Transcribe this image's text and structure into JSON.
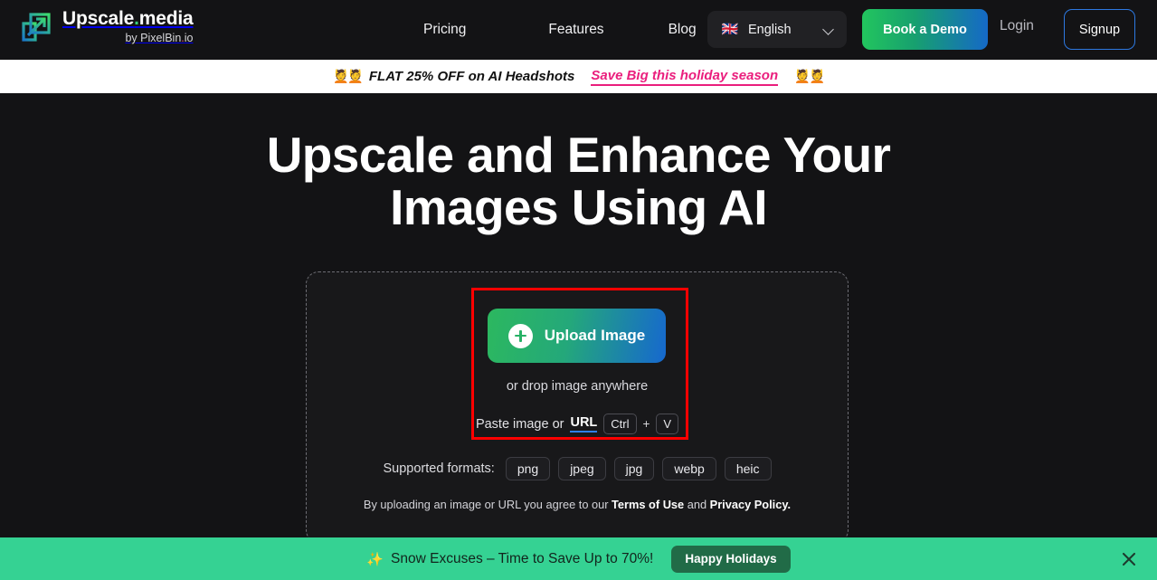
{
  "header": {
    "logo": {
      "icon": "upscale-arrow-logo-icon",
      "title_main": "Upscale",
      "title_dot": ".",
      "title_rest": "media",
      "sub_prefix": "by PixelBin",
      "sub_dot": ".",
      "sub_suffix": "io"
    },
    "nav": [
      {
        "label": "Pricing",
        "name": "nav-link-pricing"
      },
      {
        "label": "Features",
        "name": "nav-link-features"
      },
      {
        "label": "Blog",
        "name": "nav-link-blog"
      }
    ],
    "language": {
      "flag": "🇬🇧",
      "label": "English",
      "chevron": "chevron-down-icon"
    },
    "demo_button": "Book a Demo",
    "login_link": "Login",
    "signup_button": "Signup"
  },
  "promo_banner": {
    "emoji_left": "💆💆",
    "text": "FLAT 25% OFF on AI Headshots",
    "link": "Save Big this holiday season",
    "emoji_right": "💆💆"
  },
  "hero": {
    "title_line1": "Upscale and Enhance Your",
    "title_line2": "Images Using AI"
  },
  "uploader": {
    "upload_button": "Upload Image",
    "plus_icon": "plus-circle-icon",
    "drop_hint": "or drop image anywhere",
    "paste_prefix": "Paste image or",
    "paste_url": "URL",
    "key_ctrl": "Ctrl",
    "key_plus": "+",
    "key_v": "V",
    "formats_label": "Supported formats:",
    "formats": [
      "png",
      "jpeg",
      "jpg",
      "webp",
      "heic"
    ],
    "legal_prefix": "By uploading an image or URL you agree to our",
    "legal_terms": "Terms of Use",
    "legal_and": "and",
    "legal_privacy": "Privacy Policy."
  },
  "bottom_bar": {
    "emoji": "✨",
    "message": "Snow Excuses – Time to Save Up to 70%!",
    "cta": "Happy Holidays",
    "close_icon": "close-icon"
  },
  "colors": {
    "page_bg": "#131315",
    "banner_bg": "#ffffff",
    "promo_link": "#ea1e7d",
    "accent_green": "#35d293",
    "accent_blue": "#2d78e0",
    "highlight_red": "#ff0000",
    "holiday_button": "#216b47"
  }
}
